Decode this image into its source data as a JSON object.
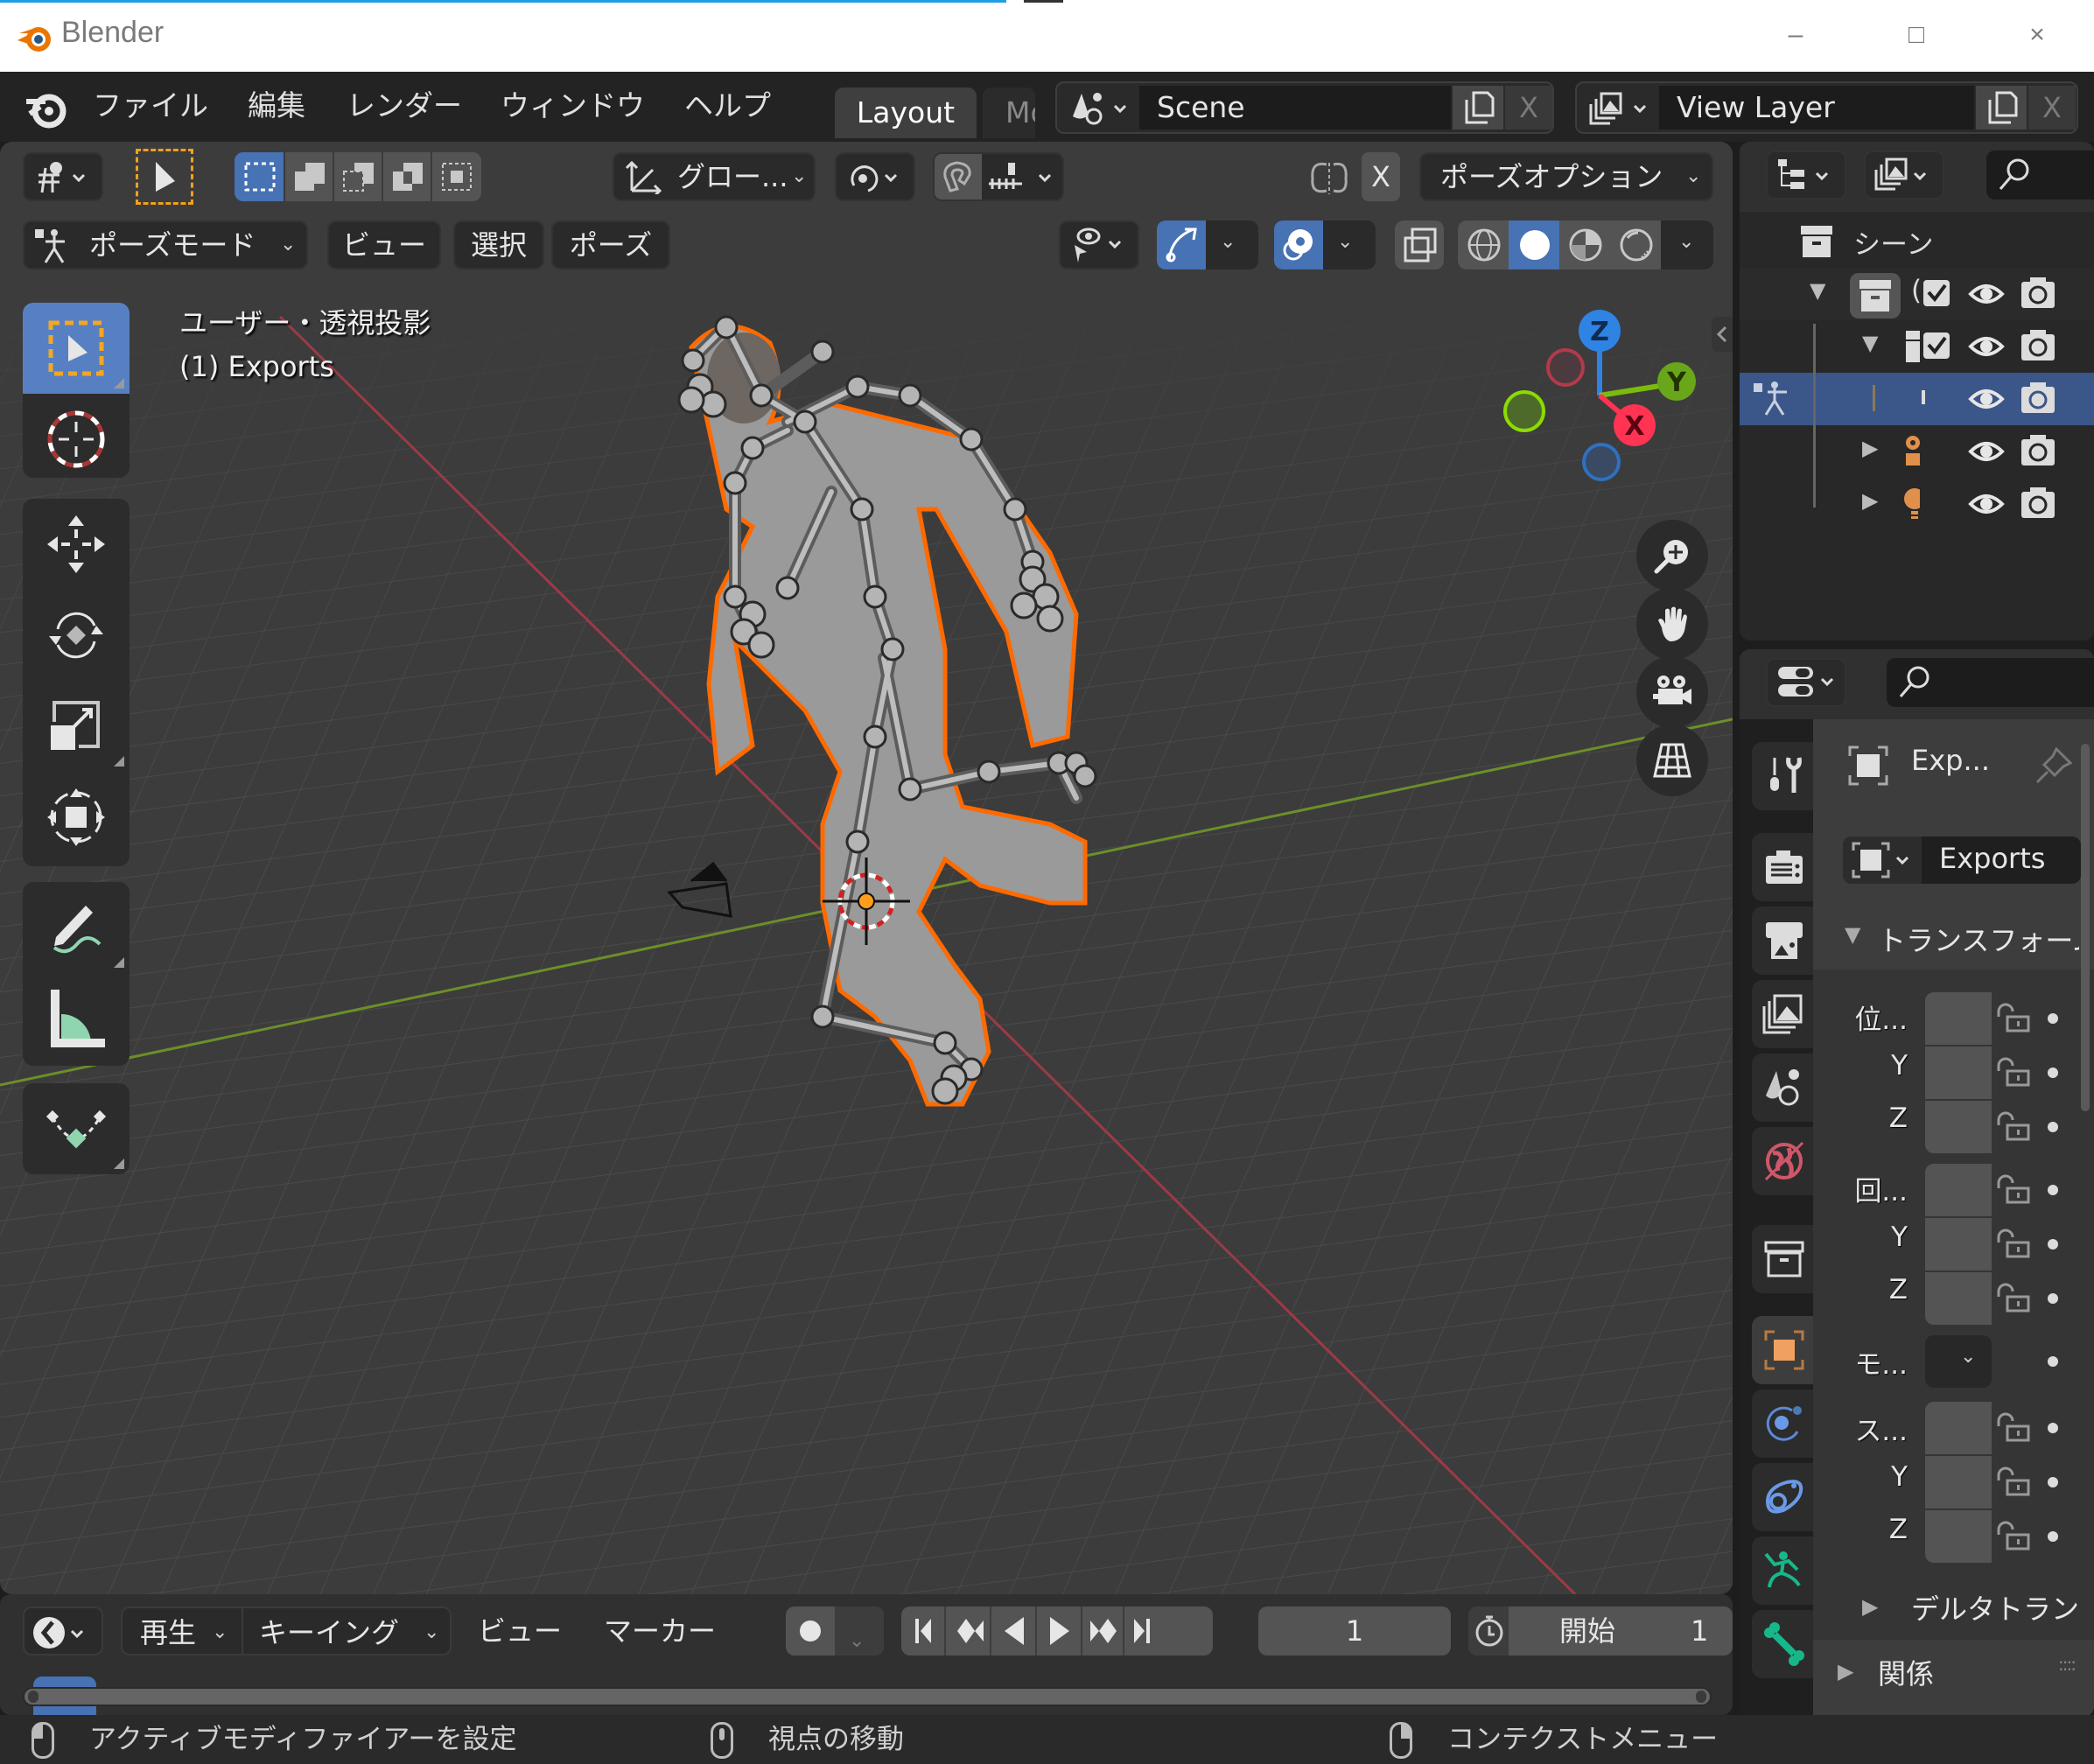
{
  "window": {
    "title": "Blender",
    "controls": {
      "minimize": "–",
      "maximize": "□",
      "close": "×"
    }
  },
  "menubar": {
    "items": [
      "ファイル",
      "編集",
      "レンダー",
      "ウィンドウ",
      "ヘルプ"
    ],
    "workspace_tabs": [
      {
        "label": "Layout",
        "active": true
      },
      {
        "label": "Mo",
        "active": false
      }
    ],
    "scene": {
      "value": "Scene",
      "close": "X"
    },
    "view_layer": {
      "value": "View Layer",
      "close": "X"
    }
  },
  "viewport_header": {
    "row1": {
      "transform_orientation": "グロー...",
      "mirror_axis": "X",
      "pose_options": "ポーズオプション"
    },
    "row2": {
      "mode": "ポーズモード",
      "menus": [
        "ビュー",
        "選択",
        "ポーズ"
      ]
    },
    "shading_modes": [
      {
        "name": "wireframe",
        "active": false
      },
      {
        "name": "solid",
        "active": true
      },
      {
        "name": "material-preview",
        "active": false
      },
      {
        "name": "rendered",
        "active": false
      }
    ]
  },
  "viewport": {
    "view_name": "ユーザー・透視投影",
    "object_info": "(1) Exports",
    "gizmo_axes": [
      "Z",
      "Y",
      "X"
    ],
    "colors": {
      "x_axis": "#ff3352",
      "y_axis": "#8bdc00",
      "z_axis": "#2f83e3",
      "selection_outline": "#ff6a00",
      "grid_bg": "#3c3c3c"
    }
  },
  "toolbar": {
    "tools": [
      {
        "name": "select-box",
        "active": true
      },
      {
        "name": "cursor",
        "active": false
      },
      {
        "name": "move",
        "active": false
      },
      {
        "name": "rotate",
        "active": false
      },
      {
        "name": "scale",
        "active": false
      },
      {
        "name": "transform",
        "active": false
      },
      {
        "name": "annotate",
        "active": false
      },
      {
        "name": "measure",
        "active": false
      },
      {
        "name": "relax-pose",
        "active": false
      }
    ]
  },
  "outliner": {
    "rows": [
      {
        "label": "シーン",
        "icon": "scene-collection-icon",
        "expand": "",
        "checkbox": false
      },
      {
        "label": "(",
        "icon": "collection-icon",
        "expand": "▼",
        "checkbox": true
      },
      {
        "label": "",
        "icon": "collection-icon",
        "expand": "▼",
        "checkbox": true
      },
      {
        "label": "",
        "icon": "armature-icon",
        "expand": "",
        "checkbox": false,
        "selected": true
      },
      {
        "label": "",
        "icon": "camera-object-icon",
        "expand": "▶",
        "checkbox": false
      },
      {
        "label": "",
        "icon": "light-object-icon",
        "expand": "▶",
        "checkbox": false
      }
    ]
  },
  "properties": {
    "object_name_header": "Exp...",
    "object_selector_value": "Exports",
    "transform_panel": "トランスフォーム",
    "location_label": "位...",
    "rotation_label": "回...",
    "mode_label": "モ...",
    "scale_label": "ス...",
    "axis_y": "Y",
    "axis_z": "Z",
    "delta_transform": "デルタトラン",
    "relations": "関係"
  },
  "timeline": {
    "playback": "再生",
    "keying": "キーイング",
    "view": "ビュー",
    "marker": "マーカー",
    "current_frame": "1",
    "start_label": "開始",
    "start_value": "1"
  },
  "statusbar": {
    "left": "アクティブモディファイアーを設定",
    "middle": "視点の移動",
    "right": "コンテクストメニュー"
  }
}
